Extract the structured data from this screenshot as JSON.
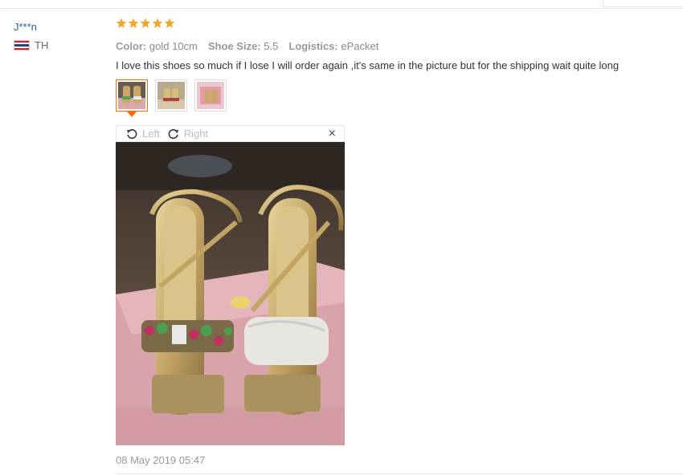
{
  "reviewer": {
    "name": "J***n",
    "country": "TH"
  },
  "rating": {
    "stars": 5,
    "max": 5,
    "color": "#f5a623"
  },
  "attributes": [
    {
      "label": "Color:",
      "value": "gold 10cm"
    },
    {
      "label": "Shoe Size:",
      "value": "5.5"
    },
    {
      "label": "Logistics:",
      "value": "ePacket"
    }
  ],
  "review_text": "I love this shoes so much if I lose I will order again ,it's same in the picture but for the shipping wait quite long",
  "thumbnails": [
    {
      "name": "photo-1",
      "active": true
    },
    {
      "name": "photo-2",
      "active": false
    },
    {
      "name": "photo-3",
      "active": false
    }
  ],
  "viewer": {
    "rotate_left": "Left",
    "rotate_right": "Right",
    "close": "×"
  },
  "date": "08 May 2019 05:47",
  "colors": {
    "accent": "#ff6a00",
    "username": "#2a5ea8"
  }
}
